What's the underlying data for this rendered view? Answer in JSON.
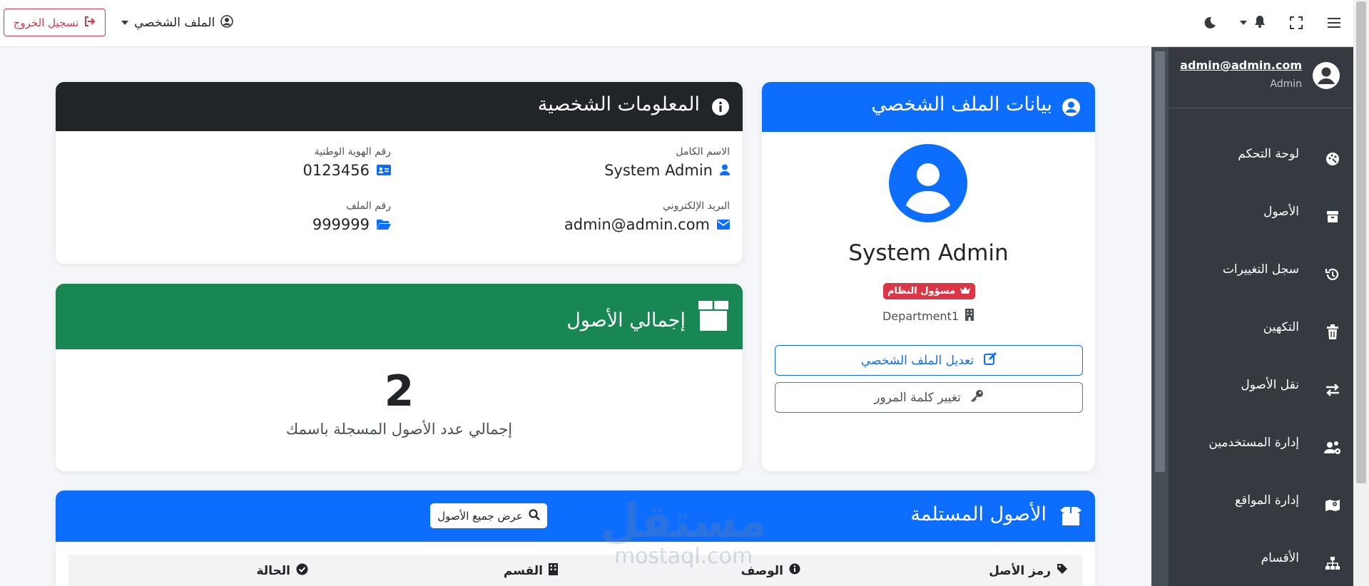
{
  "navbar": {
    "logout_label": "تسجيل الخروج",
    "profile_label": "الملف الشخصي"
  },
  "sidebar": {
    "user_email": "admin@admin.com",
    "user_role": "Admin",
    "items": [
      {
        "label": "لوحة التحكم",
        "icon": "palette-icon"
      },
      {
        "label": "الأصول",
        "icon": "archive-icon"
      },
      {
        "label": "سجل التغييرات",
        "icon": "history-icon"
      },
      {
        "label": "التكهين",
        "icon": "trash-icon"
      },
      {
        "label": "نقل الأصول",
        "icon": "exchange-icon"
      },
      {
        "label": "إدارة المستخدمين",
        "icon": "users-cog-icon"
      },
      {
        "label": "إدارة المواقع",
        "icon": "map-icon"
      },
      {
        "label": "الأقسام",
        "icon": "sitemap-icon"
      }
    ]
  },
  "profile_card": {
    "title": "بيانات الملف الشخصي",
    "name": "System Admin",
    "role_badge": "مسؤول النظام",
    "department": "Department1",
    "edit_button": "تعديل الملف الشخصي",
    "password_button": "تغيير كلمة المرور"
  },
  "personal_info": {
    "title": "المعلومات الشخصية",
    "full_name_label": "الاسم الكامل",
    "full_name": "System Admin",
    "national_id_label": "رقم الهوية الوطنية",
    "national_id": "0123456",
    "email_label": "البريد الإلكتروني",
    "email": "admin@admin.com",
    "file_number_label": "رقم الملف",
    "file_number": "999999"
  },
  "assets_total": {
    "title": "إجمالي الأصول",
    "count": "2",
    "description": "إجمالي عدد الأصول المسجلة باسمك"
  },
  "received_assets": {
    "title": "الأصول المستلمة",
    "view_all_button": "عرض جميع الأصول",
    "columns": [
      "رمز الأصل",
      "الوصف",
      "القسم",
      "الحالة"
    ]
  },
  "watermark": {
    "arabic": "مستقل",
    "latin": "mostaql.com"
  },
  "colors": {
    "primary": "#0d6efd",
    "dark": "#212529",
    "success": "#198754",
    "danger": "#dc3545",
    "sidebar": "#343a40"
  }
}
